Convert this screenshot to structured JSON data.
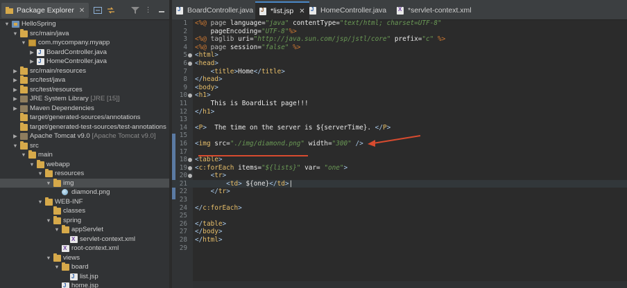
{
  "package_explorer": {
    "title": "Package Explorer",
    "tree": [
      {
        "label": "HelloSpring",
        "depth": 0,
        "open": true,
        "icon": "project-icon"
      },
      {
        "label": "src/main/java",
        "depth": 1,
        "open": true,
        "icon": "source-folder-icon"
      },
      {
        "label": "com.mycompany.myapp",
        "depth": 2,
        "open": true,
        "icon": "package-icon"
      },
      {
        "label": "BoardController.java",
        "depth": 3,
        "open": false,
        "icon": "java-file-icon",
        "twisty": "closed"
      },
      {
        "label": "HomeController.java",
        "depth": 3,
        "open": false,
        "icon": "java-file-icon",
        "twisty": "closed"
      },
      {
        "label": "src/main/resources",
        "depth": 1,
        "icon": "source-folder-icon",
        "twisty": "closed"
      },
      {
        "label": "src/test/java",
        "depth": 1,
        "icon": "source-folder-icon",
        "twisty": "closed"
      },
      {
        "label": "src/test/resources",
        "depth": 1,
        "icon": "source-folder-icon",
        "twisty": "closed"
      },
      {
        "label": "JRE System Library",
        "suffix": " [JRE [15]]",
        "depth": 1,
        "icon": "library-icon",
        "twisty": "closed"
      },
      {
        "label": "Maven Dependencies",
        "depth": 1,
        "icon": "library-icon",
        "twisty": "closed"
      },
      {
        "label": "target/generated-sources/annotations",
        "depth": 1,
        "icon": "folder-icon"
      },
      {
        "label": "target/generated-test-sources/test-annotations",
        "depth": 1,
        "icon": "folder-icon"
      },
      {
        "label": "Apache Tomcat v9.0",
        "suffix": " [Apache Tomcat v9.0]",
        "depth": 1,
        "icon": "library-icon",
        "twisty": "closed"
      },
      {
        "label": "src",
        "depth": 1,
        "icon": "folder-icon",
        "twisty": "open"
      },
      {
        "label": "main",
        "depth": 2,
        "icon": "folder-icon",
        "twisty": "open"
      },
      {
        "label": "webapp",
        "depth": 3,
        "icon": "folder-icon",
        "twisty": "open"
      },
      {
        "label": "resources",
        "depth": 4,
        "icon": "folder-icon",
        "twisty": "open"
      },
      {
        "label": "img",
        "depth": 5,
        "icon": "folder-icon",
        "twisty": "open",
        "selected": true
      },
      {
        "label": "diamond.png",
        "depth": 6,
        "icon": "image-file-icon"
      },
      {
        "label": "WEB-INF",
        "depth": 4,
        "icon": "folder-icon",
        "twisty": "open"
      },
      {
        "label": "classes",
        "depth": 5,
        "icon": "folder-icon"
      },
      {
        "label": "spring",
        "depth": 5,
        "icon": "folder-icon",
        "twisty": "open"
      },
      {
        "label": "appServlet",
        "depth": 6,
        "icon": "folder-icon",
        "twisty": "open"
      },
      {
        "label": "servlet-context.xml",
        "depth": 7,
        "icon": "xml-file-icon"
      },
      {
        "label": "root-context.xml",
        "depth": 6,
        "icon": "xml-file-icon"
      },
      {
        "label": "views",
        "depth": 5,
        "icon": "folder-icon",
        "twisty": "open"
      },
      {
        "label": "board",
        "depth": 6,
        "icon": "folder-icon",
        "twisty": "open"
      },
      {
        "label": "list.jsp",
        "depth": 7,
        "icon": "jsp-file-icon"
      },
      {
        "label": "home.jsp",
        "depth": 6,
        "icon": "jsp-file-icon"
      }
    ]
  },
  "editor": {
    "tabs": [
      {
        "label": "BoardController.java",
        "icon": "java-file-icon",
        "active": false
      },
      {
        "label": "*list.jsp",
        "icon": "jsp-file-icon",
        "active": true
      },
      {
        "label": "HomeController.java",
        "icon": "java-file-icon",
        "active": false
      },
      {
        "label": "*servlet-context.xml",
        "icon": "xml-file-icon",
        "active": false
      }
    ],
    "lines": [
      {
        "n": "1",
        "fold": false,
        "tokens": [
          [
            "dir",
            "<%@ "
          ],
          [
            "at",
            "page "
          ],
          [
            "attr",
            "language="
          ],
          [
            "val",
            "\"java\""
          ],
          [
            "attr",
            " contentType="
          ],
          [
            "val",
            "\"text/html; charset=UTF-8\""
          ]
        ]
      },
      {
        "n": "2",
        "fold": false,
        "tokens": [
          [
            "attr",
            "    pageEncoding="
          ],
          [
            "val",
            "\"UTF-8\""
          ],
          [
            "dir",
            "%>"
          ]
        ]
      },
      {
        "n": "3",
        "fold": false,
        "tokens": [
          [
            "dir",
            "<%@ "
          ],
          [
            "at",
            "taglib "
          ],
          [
            "attr",
            "uri="
          ],
          [
            "val",
            "\"http://java.sun.com/jsp/jstl/core\""
          ],
          [
            "attr",
            " prefix="
          ],
          [
            "val",
            "\"c\""
          ],
          [
            "dir",
            " %>"
          ]
        ]
      },
      {
        "n": "4",
        "fold": false,
        "tokens": [
          [
            "dir",
            "<%@ "
          ],
          [
            "at",
            "page "
          ],
          [
            "attr",
            "session="
          ],
          [
            "val",
            "\"false\""
          ],
          [
            "dir",
            " %>"
          ]
        ]
      },
      {
        "n": "5",
        "fold": true,
        "tokens": [
          [
            "tag",
            "<"
          ],
          [
            "el",
            "html"
          ],
          [
            "tag",
            ">"
          ]
        ]
      },
      {
        "n": "6",
        "fold": true,
        "tokens": [
          [
            "tag",
            "<"
          ],
          [
            "el",
            "head"
          ],
          [
            "tag",
            ">"
          ]
        ]
      },
      {
        "n": "7",
        "fold": false,
        "tokens": [
          [
            "attr",
            "    "
          ],
          [
            "tag",
            "<"
          ],
          [
            "el",
            "title"
          ],
          [
            "tag",
            ">"
          ],
          [
            "attr",
            "Home"
          ],
          [
            "tag",
            "</"
          ],
          [
            "el",
            "title"
          ],
          [
            "tag",
            ">"
          ]
        ]
      },
      {
        "n": "8",
        "fold": false,
        "tokens": [
          [
            "tag",
            "</"
          ],
          [
            "el",
            "head"
          ],
          [
            "tag",
            ">"
          ]
        ]
      },
      {
        "n": "9",
        "fold": false,
        "tokens": [
          [
            "tag",
            "<"
          ],
          [
            "el",
            "body"
          ],
          [
            "tag",
            ">"
          ]
        ]
      },
      {
        "n": "10",
        "fold": true,
        "tokens": [
          [
            "tag",
            "<"
          ],
          [
            "el",
            "h1"
          ],
          [
            "tag",
            ">"
          ]
        ]
      },
      {
        "n": "11",
        "fold": false,
        "tokens": [
          [
            "attr",
            "    This is BoardList page!!!"
          ]
        ]
      },
      {
        "n": "12",
        "fold": false,
        "tokens": [
          [
            "tag",
            "</"
          ],
          [
            "el",
            "h1"
          ],
          [
            "tag",
            ">"
          ]
        ]
      },
      {
        "n": "13",
        "fold": false,
        "tokens": []
      },
      {
        "n": "14",
        "fold": false,
        "tokens": [
          [
            "tag",
            "<"
          ],
          [
            "el",
            "P"
          ],
          [
            "tag",
            ">"
          ],
          [
            "attr",
            "  The time on the server is ${serverTime}. "
          ],
          [
            "tag",
            "</"
          ],
          [
            "el",
            "P"
          ],
          [
            "tag",
            ">"
          ]
        ]
      },
      {
        "n": "15",
        "fold": false,
        "tokens": []
      },
      {
        "n": "16",
        "fold": false,
        "tokens": [
          [
            "tag",
            "<"
          ],
          [
            "el",
            "img"
          ],
          [
            "attr",
            " src="
          ],
          [
            "val",
            "\"./img/diamond.png\""
          ],
          [
            "attr",
            " width="
          ],
          [
            "val",
            "\"300\""
          ],
          [
            "tag",
            " />"
          ]
        ]
      },
      {
        "n": "17",
        "fold": false,
        "tokens": []
      },
      {
        "n": "18",
        "fold": true,
        "tokens": [
          [
            "tag",
            "<"
          ],
          [
            "el",
            "table"
          ],
          [
            "tag",
            ">"
          ]
        ]
      },
      {
        "n": "19",
        "fold": true,
        "tokens": [
          [
            "tag",
            "<"
          ],
          [
            "el",
            "c:forEach"
          ],
          [
            "attr",
            " items="
          ],
          [
            "val",
            "\"${lists}\""
          ],
          [
            "attr",
            " var= "
          ],
          [
            "val",
            "\"one\""
          ],
          [
            "tag",
            ">"
          ]
        ]
      },
      {
        "n": "20",
        "fold": true,
        "tokens": [
          [
            "attr",
            "    "
          ],
          [
            "tag",
            "<"
          ],
          [
            "el",
            "tr"
          ],
          [
            "tag",
            ">"
          ]
        ]
      },
      {
        "n": "21",
        "fold": false,
        "hl": true,
        "tokens": [
          [
            "attr",
            "        "
          ],
          [
            "tag",
            "<"
          ],
          [
            "el",
            "td"
          ],
          [
            "tag",
            "> "
          ],
          [
            "attr",
            "${one}"
          ],
          [
            "tag",
            "</"
          ],
          [
            "el",
            "td"
          ],
          [
            "tag",
            ">"
          ],
          [
            "attr",
            "|"
          ]
        ]
      },
      {
        "n": "22",
        "fold": false,
        "tokens": [
          [
            "attr",
            "    "
          ],
          [
            "tag",
            "</"
          ],
          [
            "el",
            "tr"
          ],
          [
            "tag",
            ">"
          ]
        ]
      },
      {
        "n": "23",
        "fold": false,
        "tokens": []
      },
      {
        "n": "24",
        "fold": false,
        "tokens": [
          [
            "tag",
            "</"
          ],
          [
            "el",
            "c:forEach"
          ],
          [
            "tag",
            ">"
          ]
        ]
      },
      {
        "n": "25",
        "fold": false,
        "tokens": []
      },
      {
        "n": "26",
        "fold": false,
        "tokens": [
          [
            "tag",
            "</"
          ],
          [
            "el",
            "table"
          ],
          [
            "tag",
            ">"
          ]
        ]
      },
      {
        "n": "27",
        "fold": false,
        "tokens": [
          [
            "tag",
            "</"
          ],
          [
            "el",
            "body"
          ],
          [
            "tag",
            ">"
          ]
        ]
      },
      {
        "n": "28",
        "fold": false,
        "tokens": [
          [
            "tag",
            "</"
          ],
          [
            "el",
            "html"
          ],
          [
            "tag",
            ">"
          ]
        ]
      },
      {
        "n": "29",
        "fold": false,
        "tokens": []
      }
    ]
  },
  "colors": {
    "annotation_red": "#d84b2f",
    "active_tab_accent": "#4a88c7"
  }
}
